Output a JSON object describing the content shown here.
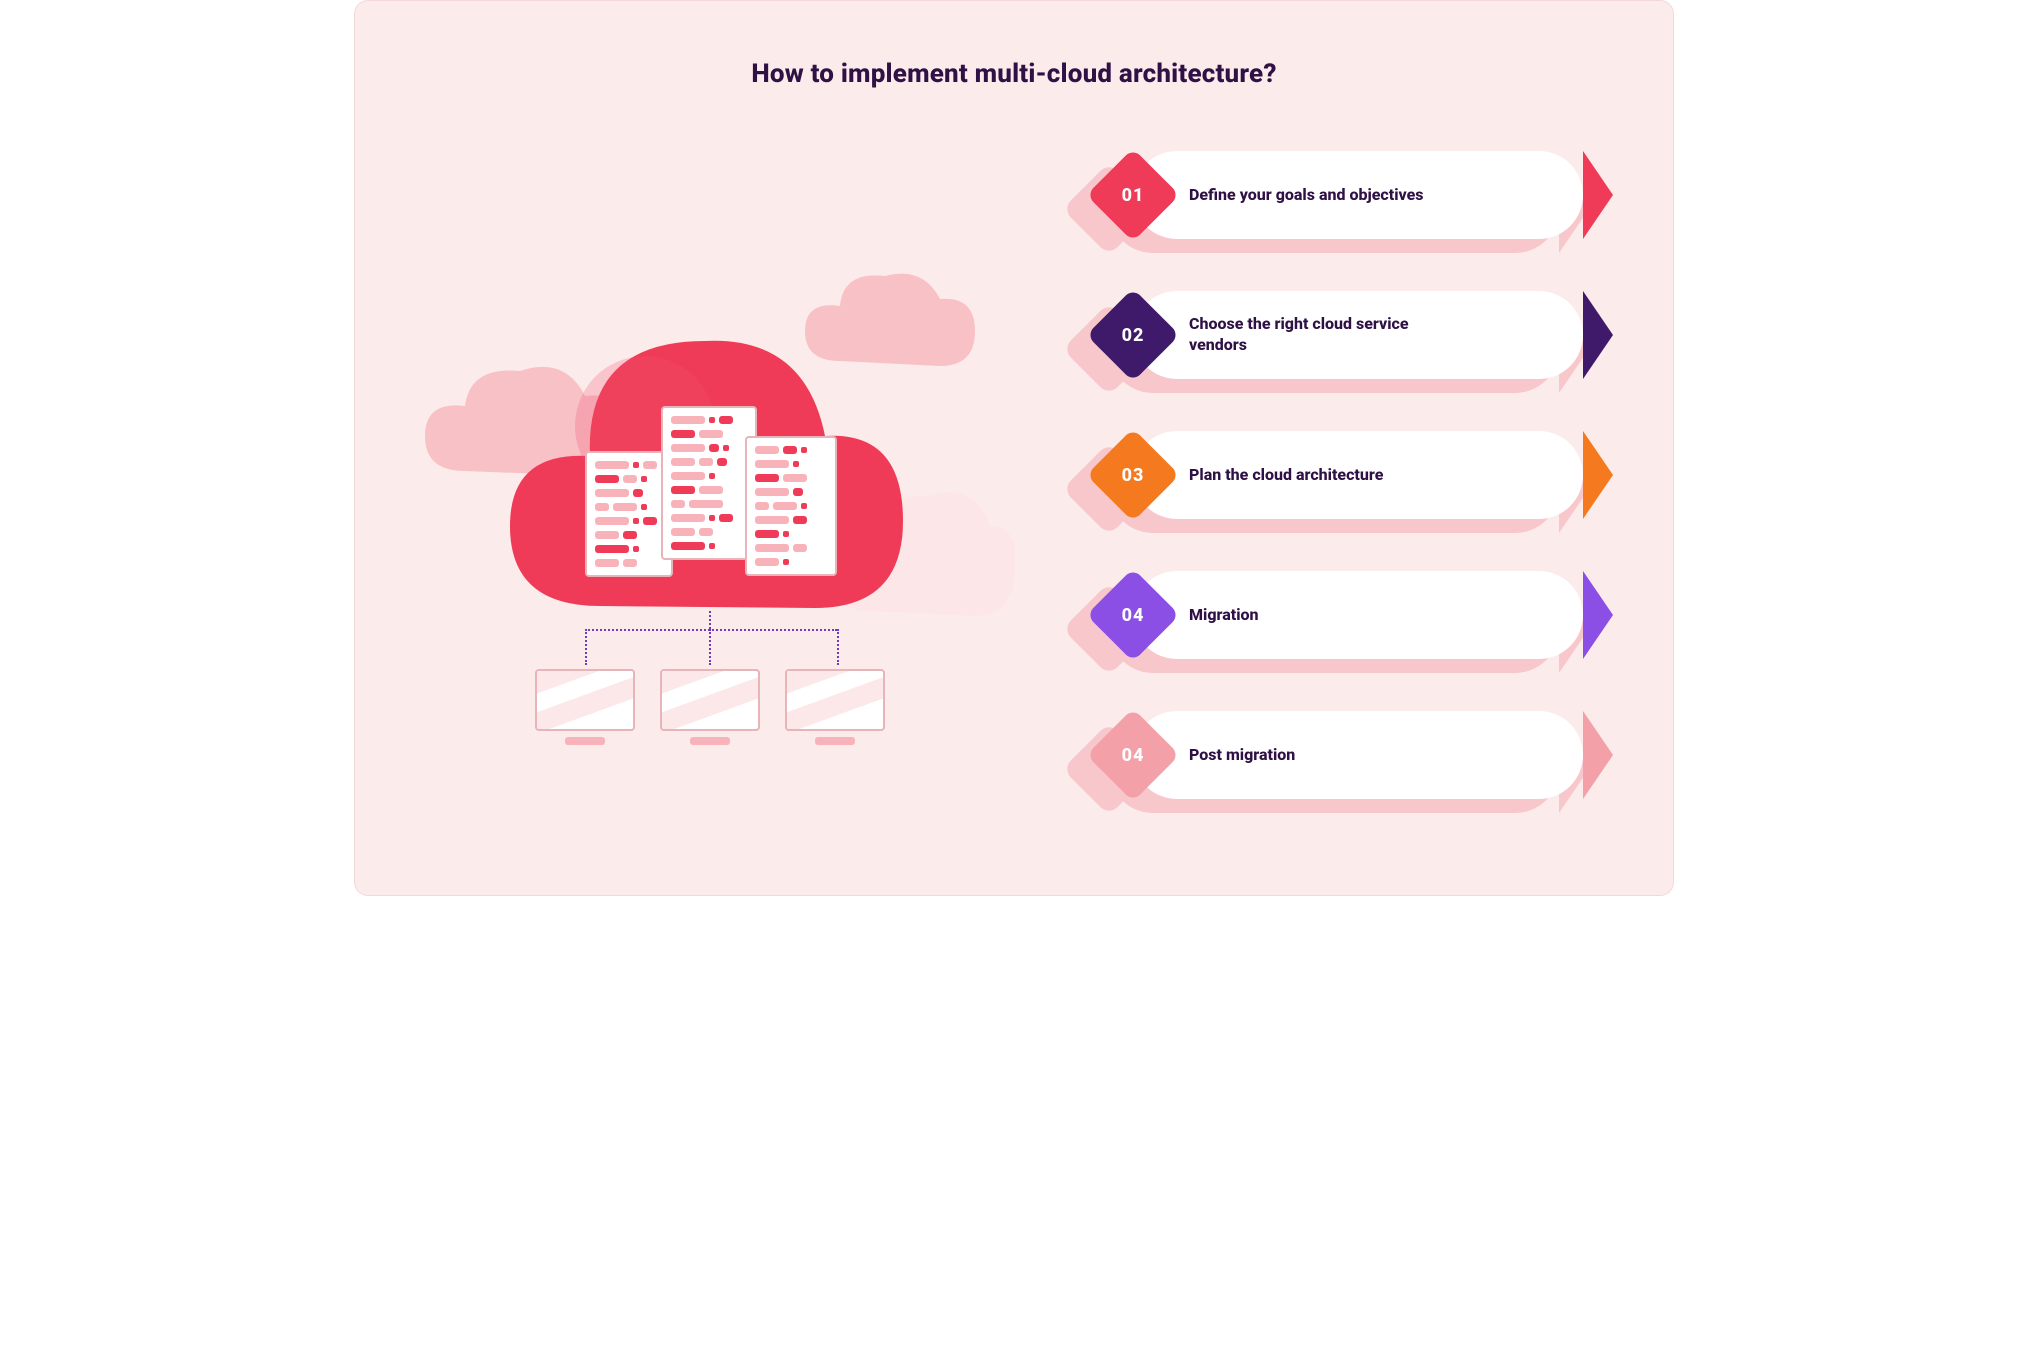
{
  "title": "How to implement multi-cloud architecture?",
  "steps": [
    {
      "num": "01",
      "label": "Define your goals and objectives",
      "color": "#ef3b57"
    },
    {
      "num": "02",
      "label": "Choose the right cloud service vendors",
      "color": "#3f1a6b"
    },
    {
      "num": "03",
      "label": "Plan the cloud architecture",
      "color": "#f57a1f"
    },
    {
      "num": "04",
      "label": "Migration",
      "color": "#8b4fe6"
    },
    {
      "num": "04",
      "label": "Post migration",
      "color": "#f3a0a8"
    }
  ],
  "illustration": {
    "clouds": [
      "main-red",
      "bg-pink-left",
      "bg-pink-right-top",
      "bg-pink-right-bottom"
    ],
    "servers": 3,
    "monitors": 3
  },
  "colors": {
    "page_bg": "#fcebeb",
    "title": "#2f1146",
    "shadow_pink": "#f8c7cb",
    "cloud_main": "#ef3b57",
    "cloud_bg": "#f8c1c6"
  }
}
